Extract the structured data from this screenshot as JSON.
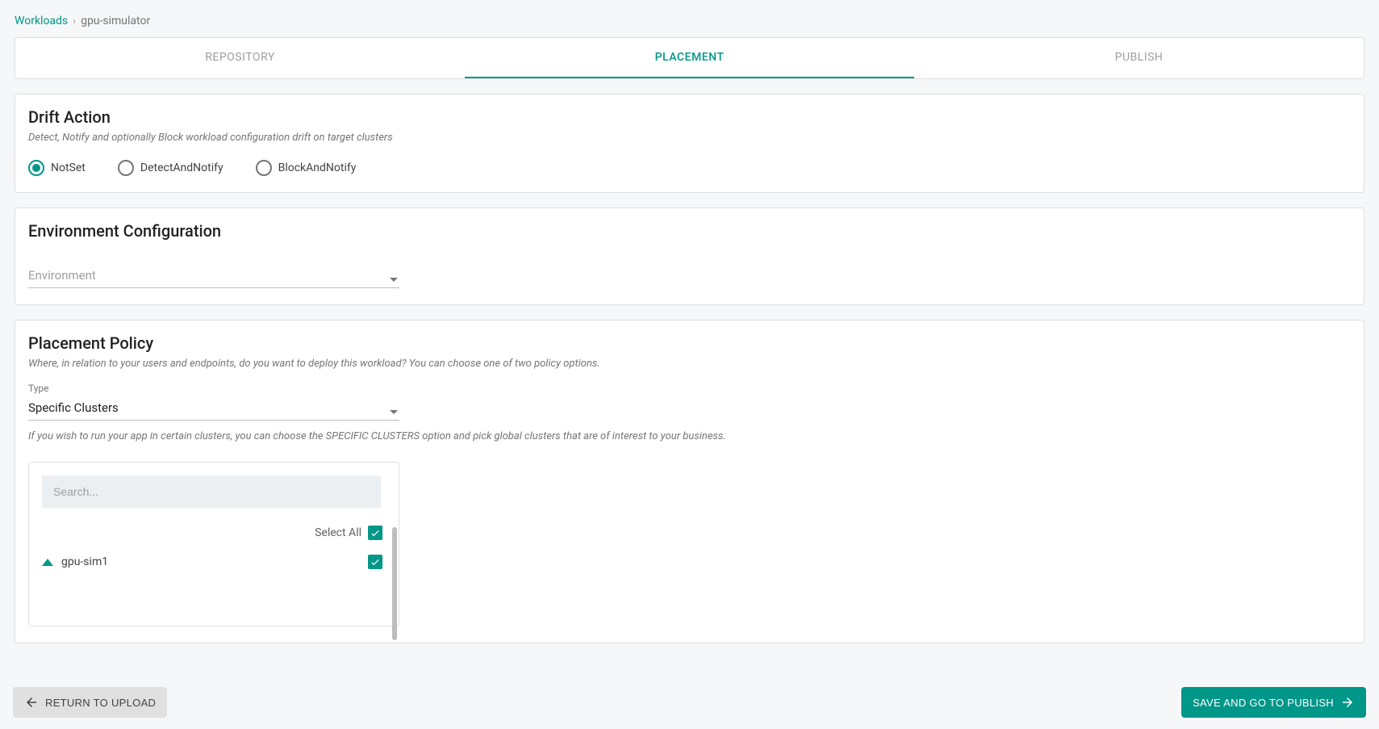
{
  "breadcrumb": {
    "root": "Workloads",
    "separator": "›",
    "leaf": "gpu-simulator"
  },
  "tabs": [
    {
      "label": "REPOSITORY",
      "active": false
    },
    {
      "label": "PLACEMENT",
      "active": true
    },
    {
      "label": "PUBLISH",
      "active": false
    }
  ],
  "drift": {
    "title": "Drift Action",
    "subtitle": "Detect, Notify and optionally Block workload configuration drift on target clusters",
    "options": [
      {
        "label": "NotSet",
        "selected": true
      },
      {
        "label": "DetectAndNotify",
        "selected": false
      },
      {
        "label": "BlockAndNotify",
        "selected": false
      }
    ]
  },
  "env": {
    "title": "Environment Configuration",
    "field_placeholder": "Environment"
  },
  "placement": {
    "title": "Placement Policy",
    "subtitle": "Where, in relation to your users and endpoints, do you want to deploy this workload? You can choose one of two policy options.",
    "type_label": "Type",
    "type_value": "Specific Clusters",
    "helper": "If you wish to run your app in certain clusters, you can choose the SPECIFIC CLUSTERS option and pick global clusters that are of interest to your business.",
    "search_placeholder": "Search...",
    "select_all_label": "Select All",
    "select_all_checked": true,
    "clusters": [
      {
        "name": "gpu-sim1",
        "checked": true
      }
    ]
  },
  "footer": {
    "back_label": "RETURN TO UPLOAD",
    "next_label": "SAVE AND GO TO PUBLISH"
  }
}
